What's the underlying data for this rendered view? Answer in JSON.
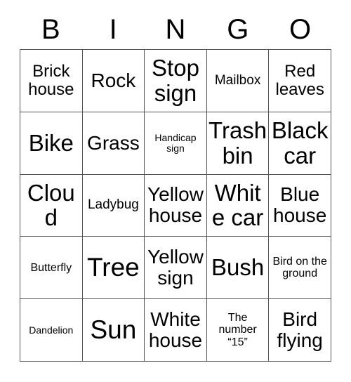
{
  "card": {
    "title": "BINGO",
    "header_letters": [
      "B",
      "I",
      "N",
      "G",
      "O"
    ],
    "border_color": "#555555",
    "text_color": "#000000",
    "background_color": "#ffffff",
    "columns": 5,
    "rows": 5,
    "cells": [
      [
        {
          "text": "Brick house",
          "size": "lg"
        },
        {
          "text": "Rock",
          "size": "xl"
        },
        {
          "text": "Stop sign",
          "size": "xxl"
        },
        {
          "text": "Mailbox",
          "size": "md"
        },
        {
          "text": "Red leaves",
          "size": "lg"
        }
      ],
      [
        {
          "text": "Bike",
          "size": "xxl"
        },
        {
          "text": "Grass",
          "size": "xl"
        },
        {
          "text": "Handicap sign",
          "size": "xs"
        },
        {
          "text": "Trash bin",
          "size": "xxl"
        },
        {
          "text": "Black car",
          "size": "xxl"
        }
      ],
      [
        {
          "text": "Cloud",
          "size": "xxl"
        },
        {
          "text": "Ladybug",
          "size": "md"
        },
        {
          "text": "Yellow house",
          "size": "xl"
        },
        {
          "text": "White car",
          "size": "xxl"
        },
        {
          "text": "Blue house",
          "size": "xl"
        }
      ],
      [
        {
          "text": "Butterfly",
          "size": "sm"
        },
        {
          "text": "Tree",
          "size": "huge"
        },
        {
          "text": "Yellow sign",
          "size": "xl"
        },
        {
          "text": "Bush",
          "size": "xxl"
        },
        {
          "text": "Bird on the ground",
          "size": "sm"
        }
      ],
      [
        {
          "text": "Dandelion",
          "size": "xs"
        },
        {
          "text": "Sun",
          "size": "huge"
        },
        {
          "text": "White house",
          "size": "xl"
        },
        {
          "text": "The number “15”",
          "size": "sm"
        },
        {
          "text": "Bird flying",
          "size": "xl"
        }
      ]
    ]
  }
}
